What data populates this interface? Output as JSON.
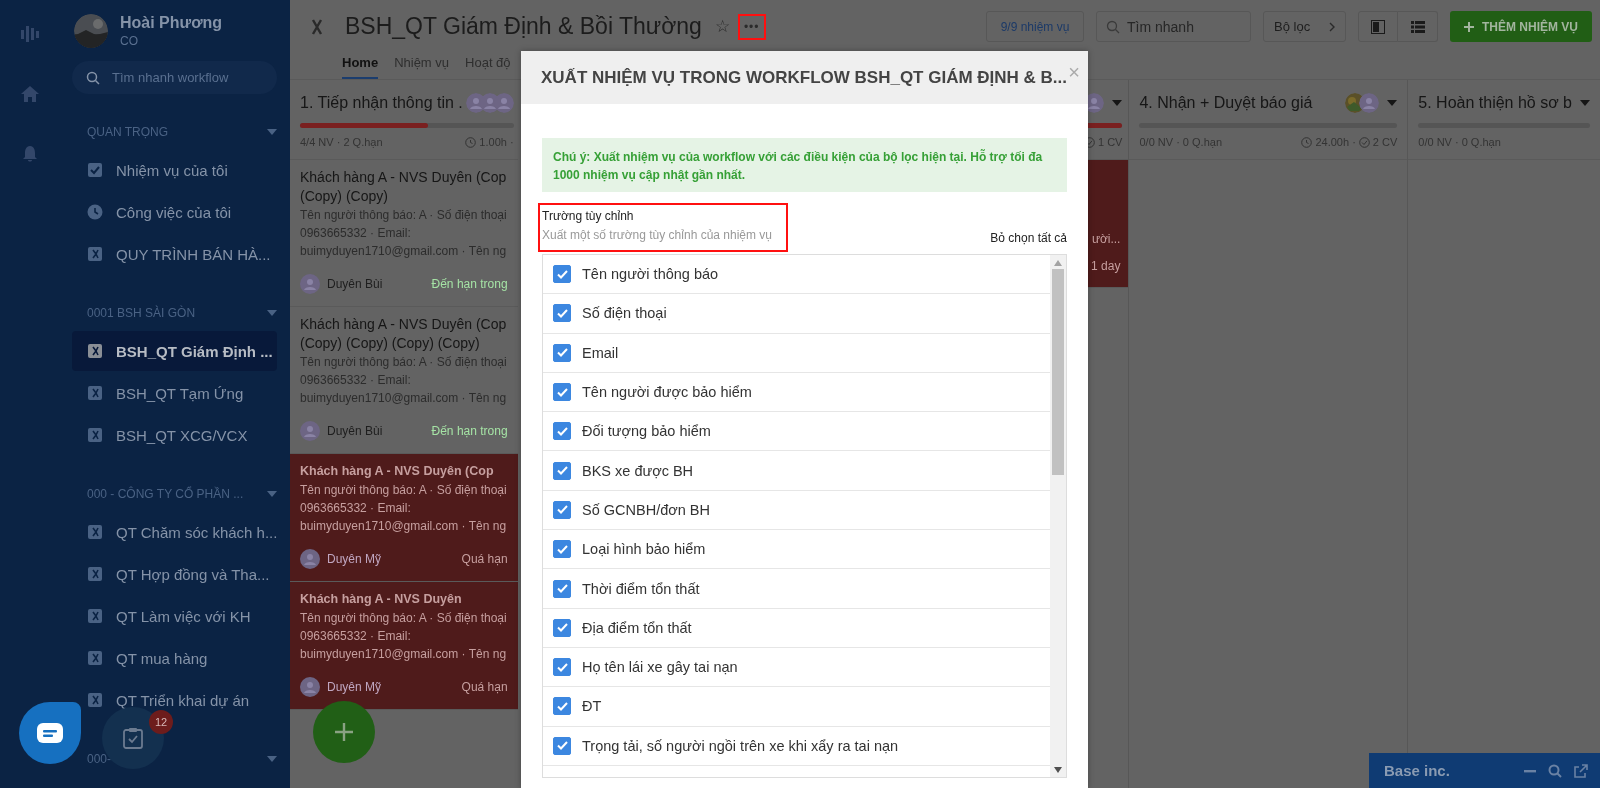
{
  "user": {
    "name": "Hoài Phương",
    "role": "CO"
  },
  "sidebar": {
    "search": {
      "placeholder": "Tìm nhanh workflow"
    },
    "groups": [
      {
        "title": "QUAN TRỌNG",
        "items": [
          {
            "label": "Nhiệm vụ của tôi",
            "kind": "task",
            "selected": false
          },
          {
            "label": "Công việc của tôi",
            "kind": "clock",
            "selected": false
          },
          {
            "label": "QUY TRÌNH BÁN HÀ...",
            "kind": "workflow",
            "selected": false
          }
        ]
      },
      {
        "title": "0001 BSH SÀI GÒN",
        "items": [
          {
            "label": "BSH_QT Giám Định ...",
            "kind": "workflow",
            "selected": true
          },
          {
            "label": "BSH_QT Tạm Ứng",
            "kind": "workflow",
            "selected": false
          },
          {
            "label": "BSH_QT XCG/VCX",
            "kind": "workflow",
            "selected": false
          }
        ]
      },
      {
        "title": "000 - CÔNG TY CỔ PHẦN ...",
        "items": [
          {
            "label": "QT Chăm sóc khách h...",
            "kind": "workflow",
            "selected": false
          },
          {
            "label": "QT Hợp đồng và Tha...",
            "kind": "workflow",
            "selected": false
          },
          {
            "label": "QT Làm việc với KH",
            "kind": "workflow",
            "selected": false
          },
          {
            "label": "QT mua hàng",
            "kind": "workflow",
            "selected": false
          },
          {
            "label": "QT Triển khai dự án",
            "kind": "workflow",
            "selected": false
          }
        ]
      },
      {
        "title": "000-"
      }
    ]
  },
  "header": {
    "title": "BSH_QT Giám Định & Bồi Thường",
    "star": "☆",
    "more": "•••",
    "tabs": [
      {
        "label": "Home",
        "selected": true
      },
      {
        "label": "Nhiệm vụ",
        "selected": false
      },
      {
        "label": "Hoạt độ",
        "selected": false
      }
    ],
    "task_count": "9/9 nhiệm vụ",
    "search": {
      "placeholder": "Tìm nhanh"
    },
    "filter": "Bộ lọc",
    "add_button": "THÊM NHIỆM VỤ"
  },
  "board": {
    "columns": [
      {
        "kind": "full",
        "title": "1. Tiếp nhận thông tin .",
        "avatars": [
          {
            "kind": "person"
          },
          {
            "kind": "person"
          },
          {
            "kind": "person"
          }
        ],
        "level": 0.6,
        "stats": "4/4 NV · 2 Q.hạn",
        "time": "1.00h ·",
        "cards": [
          {
            "title": [
              "Khách hàng A - NVS Duyên (Cop",
              "(Copy) (Copy)"
            ],
            "lines": [
              "Tên người thông báo: A · Số điện thoại",
              "0963665332 · Email:",
              "buimyduyen1710@gmail.com · Tên ng"
            ],
            "assignee": "Duyên Bùi",
            "due": "Đến hạn trong",
            "overdue": false
          },
          {
            "title": [
              "Khách hàng A - NVS Duyên (Cop",
              "(Copy) (Copy) (Copy) (Copy)"
            ],
            "lines": [
              "Tên người thông báo: A · Số điện thoại",
              "0963665332 · Email:",
              "buimyduyen1710@gmail.com · Tên ng"
            ],
            "assignee": "Duyên Bùi",
            "due": "Đến hạn trong",
            "overdue": false
          },
          {
            "title": [
              "Khách hàng A - NVS Duyên (Cop"
            ],
            "lines": [
              "Tên người thông báo: A · Số điện thoại",
              "0963665332 · Email:",
              "buimyduyen1710@gmail.com · Tên ng"
            ],
            "assignee": "Duyên Mỹ",
            "due": "Quá hạn",
            "overdue": true
          },
          {
            "title": [
              "Khách hàng A - NVS Duyên"
            ],
            "lines": [
              "Tên người thông báo: A · Số điện thoại",
              "0963665332 · Email:",
              "buimyduyen1710@gmail.com · Tên ng"
            ],
            "assignee": "Duyên Mỹ",
            "due": "Quá hạn",
            "overdue": true
          }
        ]
      },
      {
        "kind": "partial",
        "avatars": [
          {
            "kind": "person"
          }
        ],
        "level": 1,
        "count": "1 CV",
        "cards": [
          {
            "lines": [
              "ười..."
            ],
            "due": "1 day",
            "overdue": true
          }
        ]
      },
      {
        "kind": "full",
        "title": "4. Nhận + Duyệt báo giá",
        "avatars": [
          {
            "kind": "photo"
          },
          {
            "kind": "person"
          }
        ],
        "level": 0,
        "stats": "0/0 NV · 0 Q.hạn",
        "time": "24.00h ·",
        "count": "2 CV"
      },
      {
        "kind": "full",
        "title": "5. Hoàn thiện hồ sơ b",
        "level": 0,
        "stats": "0/0 NV · 0 Q.hạn"
      }
    ]
  },
  "modal": {
    "title": "XUẤT NHIỆM VỤ TRONG WORKFLOW BSH_QT GIÁM ĐỊNH & B...",
    "close": "×",
    "notice": "Chú ý: Xuất nhiệm vụ của workflow với các điều kiện của bộ lọc hiện tại. Hỗ trợ tối đa 1000 nhiệm vụ cập nhật gần nhất.",
    "section_title": "Trường tùy chỉnh",
    "section_hint": "Xuất một số trường tùy chỉnh của nhiệm vụ",
    "deselect_all": "Bỏ chọn tất cả",
    "fields": [
      {
        "label": "Tên người thông báo",
        "checked": true
      },
      {
        "label": "Số điện thoại",
        "checked": true
      },
      {
        "label": "Email",
        "checked": true
      },
      {
        "label": "Tên người được bảo hiểm",
        "checked": true
      },
      {
        "label": "Đối tượng bảo hiểm",
        "checked": true
      },
      {
        "label": "BKS xe được BH",
        "checked": true
      },
      {
        "label": "Số GCNBH/đơn BH",
        "checked": true
      },
      {
        "label": "Loại hình bảo hiểm",
        "checked": true
      },
      {
        "label": "Thời điểm tổn thất",
        "checked": true
      },
      {
        "label": "Địa điểm tổn thất",
        "checked": true
      },
      {
        "label": "Họ tên lái xe gây tai nạn",
        "checked": true
      },
      {
        "label": "ĐT",
        "checked": true
      },
      {
        "label": "Trọng tải, số người ngồi trên xe khi xẩy ra tai nạn",
        "checked": true
      }
    ]
  },
  "task_badge": "12",
  "widget": {
    "title": "Base inc."
  }
}
